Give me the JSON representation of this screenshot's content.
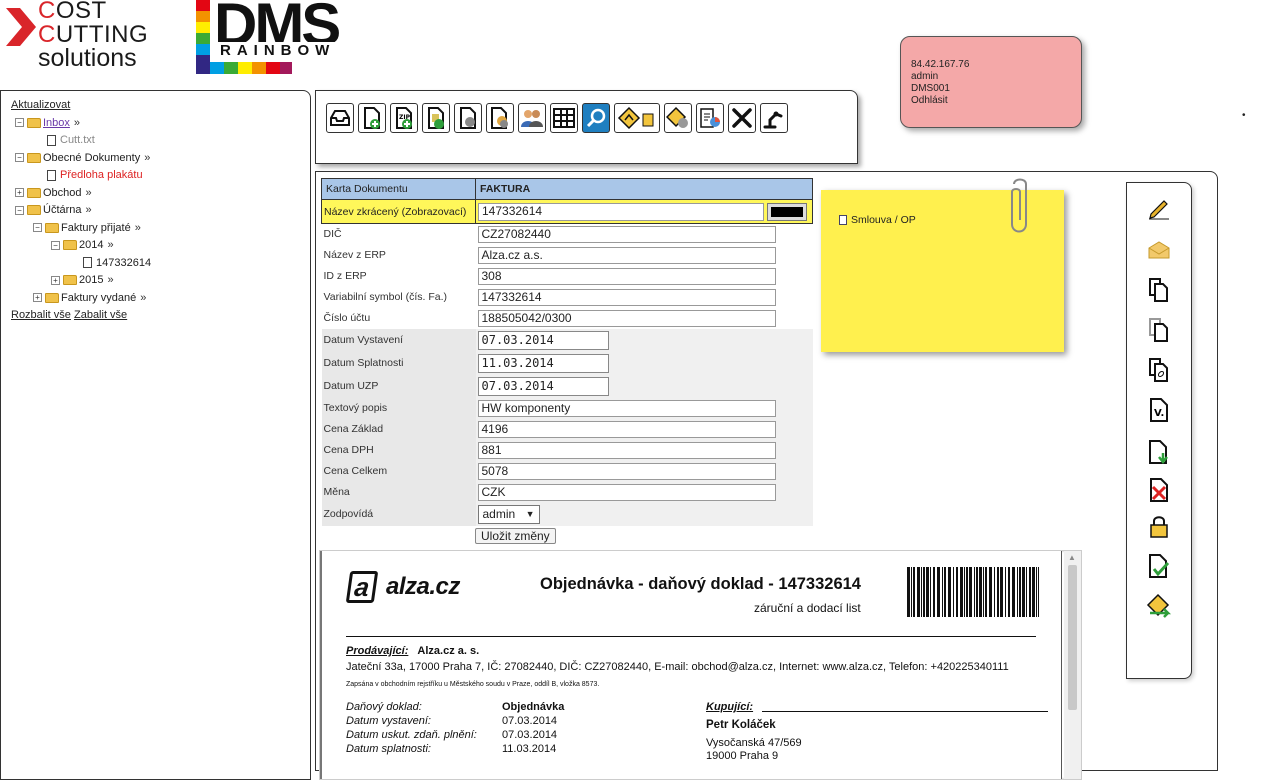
{
  "logos": {
    "ccs": {
      "line1": "OST",
      "line1_initial": "C",
      "line2": "UTTING",
      "line2_initial": "C",
      "line3": "solutions"
    },
    "dms": {
      "big": "DMS",
      "small": "RAINBOW"
    }
  },
  "user": {
    "ip": "84.42.167.76",
    "name": "admin",
    "system": "DMS001",
    "logout": "Odhlásit"
  },
  "tree": {
    "refresh": "Aktualizovat",
    "inbox": "Inbox",
    "inbox_file": "Cutt.txt",
    "general_docs": "Obecné Dokumenty",
    "general_file": "Předloha plakátu",
    "trade": "Obchod",
    "accounting": "Účtárna",
    "invoices_received": "Faktury přijaté",
    "year_2014": "2014",
    "invoice_item": "147332614",
    "year_2015": "2015",
    "invoices_issued": "Faktury vydané",
    "arrow": "»",
    "expand_all": "Rozbalit vše",
    "collapse_all": "Zabalit vše"
  },
  "form": {
    "header_label": "Karta Dokumentu",
    "header_value": "FAKTURA",
    "short_name_label": "Název zkrácený (Zobrazovací)",
    "short_name_value": "147332614",
    "fields": [
      {
        "label": "DIČ",
        "value": "CZ27082440"
      },
      {
        "label": "Název z ERP",
        "value": "Alza.cz a.s."
      },
      {
        "label": "ID z ERP",
        "value": "308"
      },
      {
        "label": "Variabilní symbol (čís. Fa.)",
        "value": "147332614"
      },
      {
        "label": "Číslo účtu",
        "value": "188505042/0300"
      },
      {
        "label": "Datum Vystavení",
        "value": "07.03.2014"
      },
      {
        "label": "Datum Splatnosti",
        "value": "11.03.2014"
      },
      {
        "label": "Datum UZP",
        "value": "07.03.2014"
      },
      {
        "label": "Textový popis",
        "value": "HW komponenty"
      },
      {
        "label": "Cena Základ",
        "value": "4196"
      },
      {
        "label": "Cena DPH",
        "value": "881"
      },
      {
        "label": "Cena Celkem",
        "value": "5078"
      },
      {
        "label": "Měna",
        "value": "CZK"
      },
      {
        "label": "Zodpovídá",
        "value": "admin"
      }
    ],
    "save_label": "Uložit změny"
  },
  "sticky": {
    "entry": "Smlouva / OP"
  },
  "document": {
    "logo_letter": "a",
    "logo_word": "alza.cz",
    "title": "Objednávka - daňový doklad - 147332614",
    "subtitle": "záruční a dodací list",
    "seller_label": "Prodávající:",
    "seller_name": "Alza.cz a. s.",
    "seller_address": "Jateční 33a, 17000 Praha 7, IČ: 27082440, DIČ:  CZ27082440, E-mail: obchod@alza.cz, Internet: www.alza.cz, Telefon: +420225340111",
    "registry": "Zapsána v obchodním rejstříku u Městského soudu v Praze, oddíl B, vložka 8573.",
    "rows": [
      {
        "label": "Daňový doklad:",
        "value": "Objednávka"
      },
      {
        "label": "Datum vystavení:",
        "value": "07.03.2014"
      },
      {
        "label": "Datum uskut. zdaň. plnění:",
        "value": "07.03.2014"
      },
      {
        "label": "Datum splatnosti:",
        "value": "11.03.2014"
      }
    ],
    "buyer_label": "Kupující:",
    "buyer_name": "Petr Koláček",
    "buyer_street": "Vysočanská 47/569",
    "buyer_city": "19000 Praha 9"
  },
  "colors": {
    "tree_link_red": "#dd2222",
    "header_blue": "#a9c6e8",
    "highlight_yellow": "#fff75a",
    "sticky_yellow": "#fff04e",
    "user_box_pink": "#f4a8a8"
  },
  "icons": {
    "toolbar": [
      "inbox-tray-icon",
      "new-document-icon",
      "zip-document-icon",
      "copy-document-icon",
      "scan-document-icon",
      "scan-group-icon",
      "users-icon",
      "table-icon",
      "search-icon",
      "sign-warning-icon",
      "sign-config-icon",
      "report-icon",
      "tools-icon",
      "robot-arm-icon"
    ],
    "side": [
      "edit-pencil-icon",
      "envelope-icon",
      "copy-icon",
      "copy-outline-icon",
      "link-copy-icon",
      "version-icon",
      "download-document-icon",
      "delete-document-icon",
      "lock-icon",
      "approve-icon",
      "forward-sign-icon"
    ]
  }
}
